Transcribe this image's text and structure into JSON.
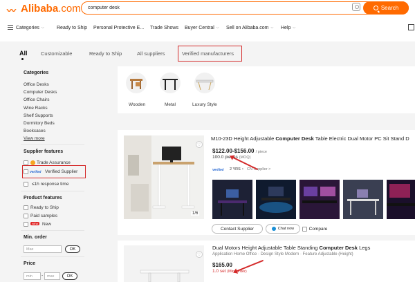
{
  "header": {
    "logo_text": "Alibaba",
    "logo_suffix": ".com",
    "search_value": "computer desk",
    "search_button": "Search"
  },
  "nav": {
    "items": [
      "Categories",
      "Ready to Ship",
      "Personal Protective E...",
      "Trade Shows",
      "Buyer Central",
      "Sell on Alibaba.com",
      "Help"
    ]
  },
  "tabs": [
    "All",
    "Customizable",
    "Ready to Ship",
    "All suppliers",
    "Verified manufacturers"
  ],
  "sidebar": {
    "categories_title": "Categories",
    "categories": [
      "Office Desks",
      "Computer Desks",
      "Office Chairs",
      "Wine Racks",
      "Shelf Supports",
      "Dormitory Beds",
      "Bookcases"
    ],
    "view_more": "View more",
    "supplier_title": "Supplier features",
    "trade_assurance": "Trade Assurance",
    "verified_badge": "Verified",
    "verified_supplier": "Verified Supplier",
    "response_time": "≤1h response time",
    "product_title": "Product features",
    "ready_to_ship": "Ready to Ship",
    "paid_samples": "Paid samples",
    "new_badge": "NEW",
    "new_label": "New",
    "min_order_title": "Min. order",
    "max_placeholder": "Max",
    "ok": "OK",
    "price_title": "Price",
    "min_placeholder": "min",
    "max2_placeholder": "max",
    "dash": "-"
  },
  "categories_strip": [
    "Wooden",
    "Metal",
    "Luxury Style"
  ],
  "product1": {
    "title_prefix": "M10-23D Height Adjustable ",
    "title_bold": "Computer Desk",
    "title_suffix": " Table Electric Dual Motor PC Sit Stand D",
    "price": "$122.00-$156.00",
    "price_unit": "/ piece",
    "moq": "100.0 pieces",
    "moq_note": "(MOQ)",
    "verified": "Verified",
    "years": "2 YRS",
    "cn_supplier": "CN Supplier >",
    "image_counter": "1/6",
    "contact": "Contact Supplier",
    "chat": "Chat now",
    "compare": "Compare"
  },
  "product2": {
    "title_prefix": "Dual Motors Height Adjustable Table Standing ",
    "title_bold": "Computer Desk",
    "title_suffix": " Legs",
    "subtitle": "Application Home Office · Design Style Modern · Feature Adjustable (Height)",
    "price": "$165.00",
    "moq": "1.0 set",
    "moq_note": "(Min. order)"
  },
  "colors": {
    "brand": "#ff6a00",
    "highlight": "#d42a2a",
    "verified_blue": "#1a5fd0"
  }
}
